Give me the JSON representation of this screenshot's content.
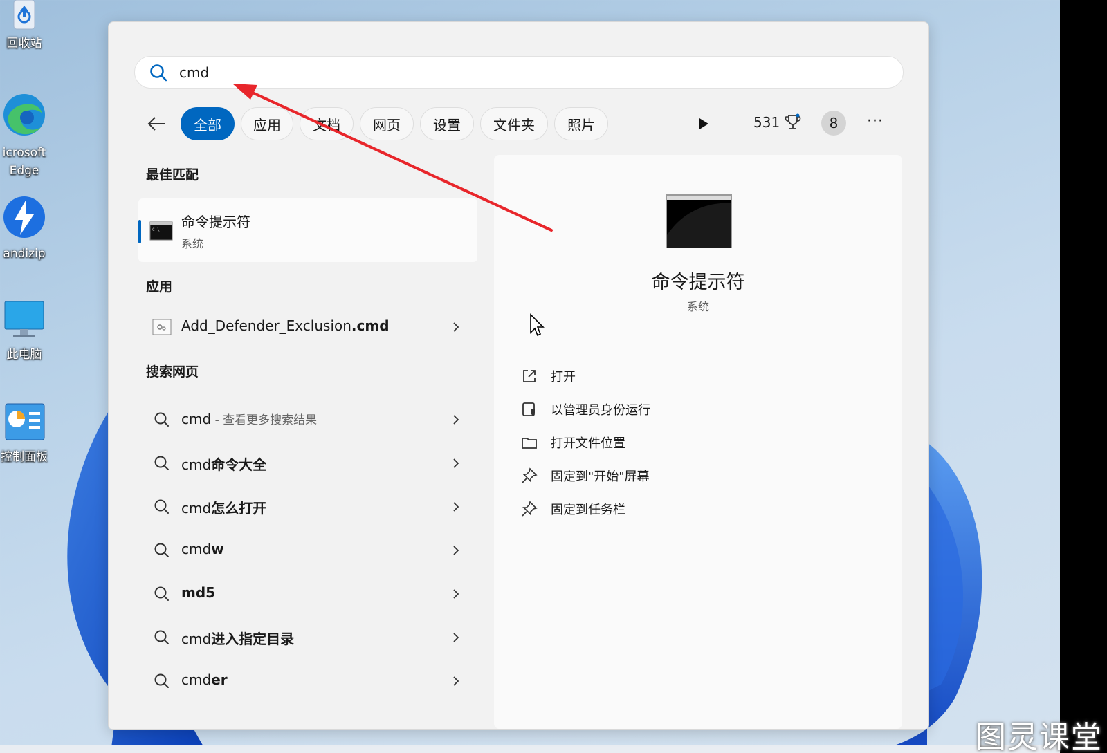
{
  "desktop": {
    "icons": [
      {
        "label": "回收站",
        "icon": "recycle-bin-icon"
      },
      {
        "label": "icrosoft",
        "label2": "Edge",
        "icon": "edge-icon"
      },
      {
        "label": "andizip",
        "icon": "bandizip-icon"
      },
      {
        "label": "此电脑",
        "icon": "this-pc-icon"
      },
      {
        "label": "控制面板",
        "icon": "control-panel-icon"
      }
    ],
    "watermark": "图灵课堂"
  },
  "search": {
    "value": "cmd",
    "icon": "search-icon"
  },
  "tabs": [
    {
      "label": "全部",
      "active": true
    },
    {
      "label": "应用"
    },
    {
      "label": "文档"
    },
    {
      "label": "网页"
    },
    {
      "label": "设置"
    },
    {
      "label": "文件夹"
    },
    {
      "label": "照片"
    }
  ],
  "toolbar": {
    "points": "531",
    "avatar_initial": "8",
    "more": "···"
  },
  "results": {
    "best_match_heading": "最佳匹配",
    "best_match": {
      "name": "命令提示符",
      "type": "系统"
    },
    "apps_heading": "应用",
    "apps": [
      {
        "prefix": "Add_Defender_Exclusion",
        "bold": ".cmd"
      }
    ],
    "web_heading": "搜索网页",
    "web": [
      {
        "prefix": "cmd",
        "bold": "",
        "suffix": " - 查看更多搜索结果"
      },
      {
        "prefix": "cmd",
        "bold": "命令大全",
        "suffix": ""
      },
      {
        "prefix": "cmd",
        "bold": "怎么打开",
        "suffix": ""
      },
      {
        "prefix": "cmd",
        "bold": "w",
        "suffix": ""
      },
      {
        "prefix": "",
        "bold": "md5",
        "suffix": ""
      },
      {
        "prefix": "cmd",
        "bold": "进入指定目录",
        "suffix": ""
      },
      {
        "prefix": "cmd",
        "bold": "er",
        "suffix": ""
      }
    ]
  },
  "detail": {
    "name": "命令提示符",
    "type": "系统",
    "actions": [
      {
        "label": "打开",
        "icon": "open-external-icon"
      },
      {
        "label": "以管理员身份运行",
        "icon": "admin-shield-icon"
      },
      {
        "label": "打开文件位置",
        "icon": "folder-icon"
      },
      {
        "label": "固定到\"开始\"屏幕",
        "icon": "pin-icon"
      },
      {
        "label": "固定到任务栏",
        "icon": "pin-icon"
      }
    ]
  },
  "colors": {
    "accent": "#0067c0",
    "arrow": "#e8262b",
    "panel_bg": "#f2f2f2"
  }
}
